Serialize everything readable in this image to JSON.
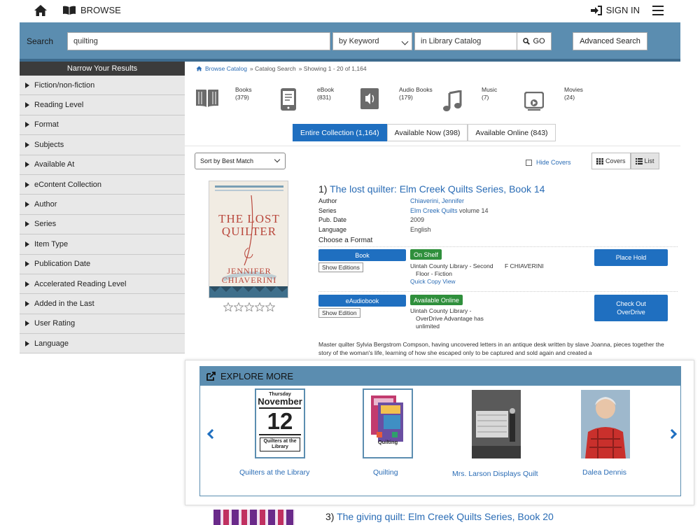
{
  "header": {
    "browse_label": "BROWSE",
    "signin_label": "SIGN IN"
  },
  "search": {
    "label": "Search",
    "query": "quilting",
    "search_by": "by Keyword",
    "scope": "in Library Catalog",
    "go_label": "GO",
    "advanced_label": "Advanced Search"
  },
  "sidebar": {
    "title": "Narrow Your Results",
    "items": [
      "Fiction/non-fiction",
      "Reading Level",
      "Format",
      "Subjects",
      "Available At",
      "eContent Collection",
      "Author",
      "Series",
      "Item Type",
      "Publication Date",
      "Accelerated Reading Level",
      "Added in the Last",
      "User Rating",
      "Language"
    ]
  },
  "breadcrumb": {
    "browse": "Browse Catalog",
    "search": "» Catalog Search",
    "showing": "» Showing 1 - 20 of 1,164"
  },
  "formats": [
    {
      "name": "Books",
      "count": "(379)",
      "icon": "book-icon"
    },
    {
      "name": "eBook",
      "count": "(831)",
      "icon": "ebook-icon"
    },
    {
      "name": "Audio Books",
      "count": "(179)",
      "icon": "audiobook-icon"
    },
    {
      "name": "Music",
      "count": "(7)",
      "icon": "music-icon"
    },
    {
      "name": "Movies",
      "count": "(24)",
      "icon": "movie-icon"
    }
  ],
  "collection_tabs": [
    {
      "label": "Entire Collection (1,164)",
      "active": true
    },
    {
      "label": "Available Now (398)",
      "active": false
    },
    {
      "label": "Available Online (843)",
      "active": false
    }
  ],
  "sort": {
    "selected": "Sort by Best Match",
    "hide_covers": "Hide Covers",
    "covers_label": "Covers",
    "list_label": "List"
  },
  "results": [
    {
      "number": "1)",
      "title": "The lost quilter: Elm Creek Quilts Series, Book 14",
      "cover_top": "THE LOST",
      "cover_title": "QUILTER",
      "cover_author1": "JENNIFER",
      "cover_author2": "CHIAVERINI",
      "author_label": "Author",
      "author": "Chiaverini, Jennifer",
      "series_label": "Series",
      "series": "Elm Creek Quilts",
      "series_vol": "volume 14",
      "pubdate_label": "Pub. Date",
      "pubdate": "2009",
      "language_label": "Language",
      "language": "English",
      "choose_label": "Choose a Format",
      "formats": [
        {
          "format": "Book",
          "editions": "Show Editions",
          "status": "On Shelf",
          "location1": "Uintah County Library - Second",
          "location2": "Floor - Fiction",
          "quick_copy": "Quick Copy View",
          "call_number": "F CHIAVERINI",
          "action": "Place Hold"
        },
        {
          "format": "eAudiobook",
          "editions": "Show Edition",
          "status": "Available Online",
          "location1": "Uintah County Library -",
          "location2": "OverDrive Advantage has",
          "location3": "unlimited",
          "action1": "Check Out",
          "action2": "OverDrive"
        }
      ],
      "description": "Master quilter Sylvia Bergstrom Compson, having uncovered letters in an antique desk written by slave Joanna, pieces together the story of the woman's life, learning of how she escaped only to be captured and sold again and created a"
    },
    {
      "number": "3)",
      "title": "The giving quilt: Elm Creek Quilts Series, Book 20"
    }
  ],
  "explore_more": {
    "title": "EXPLORE MORE",
    "calendar": {
      "day": "Thursday",
      "month": "November",
      "date": "12",
      "event": "Quilters at the Library"
    },
    "quilting_cover_label": "Quilting",
    "items": [
      "Quilters at the Library",
      "Quilting",
      "Mrs. Larson Displays Quilt",
      "Dalea Dennis"
    ]
  },
  "colors": {
    "accent": "#1f6fc0",
    "header_bar": "#5b8db0",
    "status_green": "#2f8f3c"
  }
}
